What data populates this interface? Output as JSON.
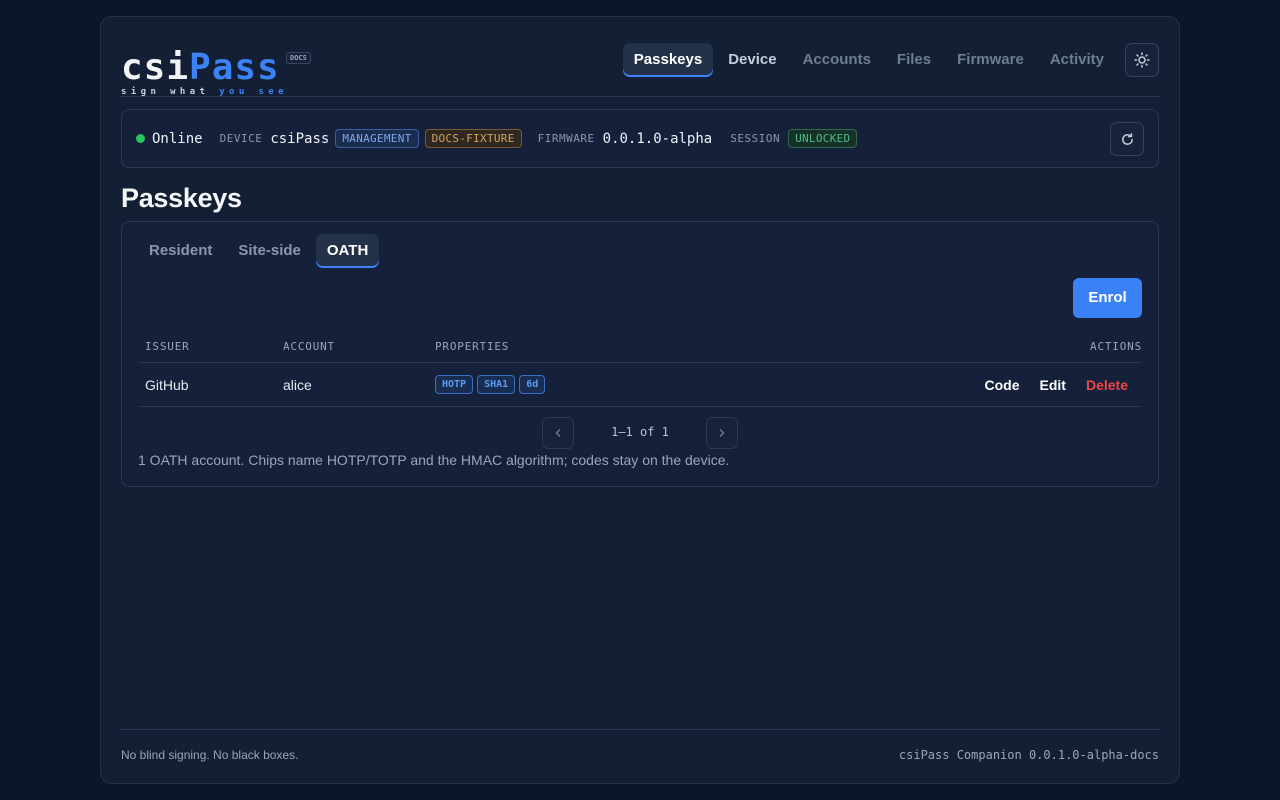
{
  "brand": {
    "logo_csi": "csi",
    "logo_pass": "Pass",
    "tagline_1": "sign what",
    "tagline_2": "you see",
    "docs_badge": "DOCS"
  },
  "nav": {
    "tabs": [
      "Passkeys",
      "Device",
      "Accounts",
      "Files",
      "Firmware",
      "Activity"
    ],
    "active": "Passkeys",
    "theme_icon": "sun-icon"
  },
  "status": {
    "online": "Online",
    "device_label": "DEVICE",
    "device_name": "csiPass",
    "chip_management": "MANAGEMENT",
    "chip_fixture": "DOCS-FIXTURE",
    "firmware_label": "FIRMWARE",
    "firmware_version": "0.0.1.0-alpha",
    "session_label": "SESSION",
    "session_state": "UNLOCKED",
    "refresh_icon": "refresh-icon",
    "colors": {
      "online": "#22c55e",
      "unlocked": "#4fbf7c",
      "fixture": "#d5a465",
      "management": "#7ea6f0"
    }
  },
  "page": {
    "title": "Passkeys"
  },
  "subtabs": {
    "items": [
      "Resident",
      "Site-side",
      "OATH"
    ],
    "active": "OATH"
  },
  "enrol_label": "Enrol",
  "table": {
    "headers": {
      "issuer": "ISSUER",
      "account": "ACCOUNT",
      "properties": "PROPERTIES",
      "actions": "ACTIONS"
    },
    "rows": [
      {
        "issuer": "GitHub",
        "account": "alice",
        "properties": [
          "HOTP",
          "SHA1",
          "6d"
        ],
        "actions": {
          "code": "Code",
          "edit": "Edit",
          "delete": "Delete"
        }
      }
    ]
  },
  "pager": {
    "text": "1–1 of 1",
    "prev_icon": "chevron-left-icon",
    "next_icon": "chevron-right-icon"
  },
  "note": "1 OATH account. Chips name HOTP/TOTP and the HMAC algorithm; codes stay on the device.",
  "footer": {
    "left": "No blind signing. No black boxes.",
    "right": "csiPass Companion 0.0.1.0-alpha-docs"
  },
  "accent": "#3b82f6",
  "danger": "#ef4444"
}
